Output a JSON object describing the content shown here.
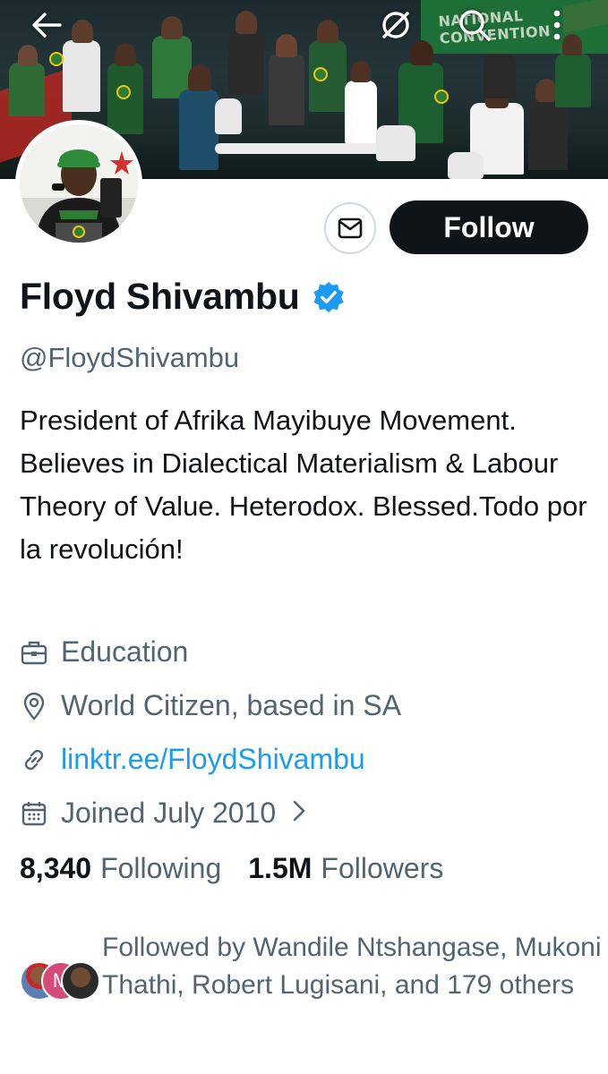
{
  "banner": {
    "text": "NATIONAL CONVENTION"
  },
  "toolbar": {
    "back_icon": "arrow-left-icon",
    "grok_icon": "grok-slash-icon",
    "search_icon": "search-icon",
    "more_icon": "more-vertical-icon"
  },
  "profile": {
    "name": "Floyd Shivambu",
    "handle": "@FloydShivambu",
    "verified": true,
    "bio": "President of Afrika Mayibuye Movement. Believes in Dialectical Materialism & Labour Theory of Value. Heterodox. Blessed.Todo por la revolución!",
    "category": "Education",
    "location": "World Citizen, based in SA",
    "link": "linktr.ee/FloydShivambu",
    "joined": "Joined July 2010"
  },
  "actions": {
    "follow_label": "Follow",
    "message_icon": "envelope-icon"
  },
  "stats": {
    "following_count": "8,340",
    "following_label": "Following",
    "followers_count": "1.5M",
    "followers_label": "Followers"
  },
  "followed_by": {
    "text": "Followed by Wandile Ntshangase, Mukoni Thathi, Robert Lugisani, and 179 others",
    "avatar_letter": "M"
  },
  "colors": {
    "accent": "#1d9bf0",
    "text": "#0f1419",
    "secondary": "#536471",
    "follow_bg": "#0f1419",
    "verified": "#1d9bf0"
  }
}
